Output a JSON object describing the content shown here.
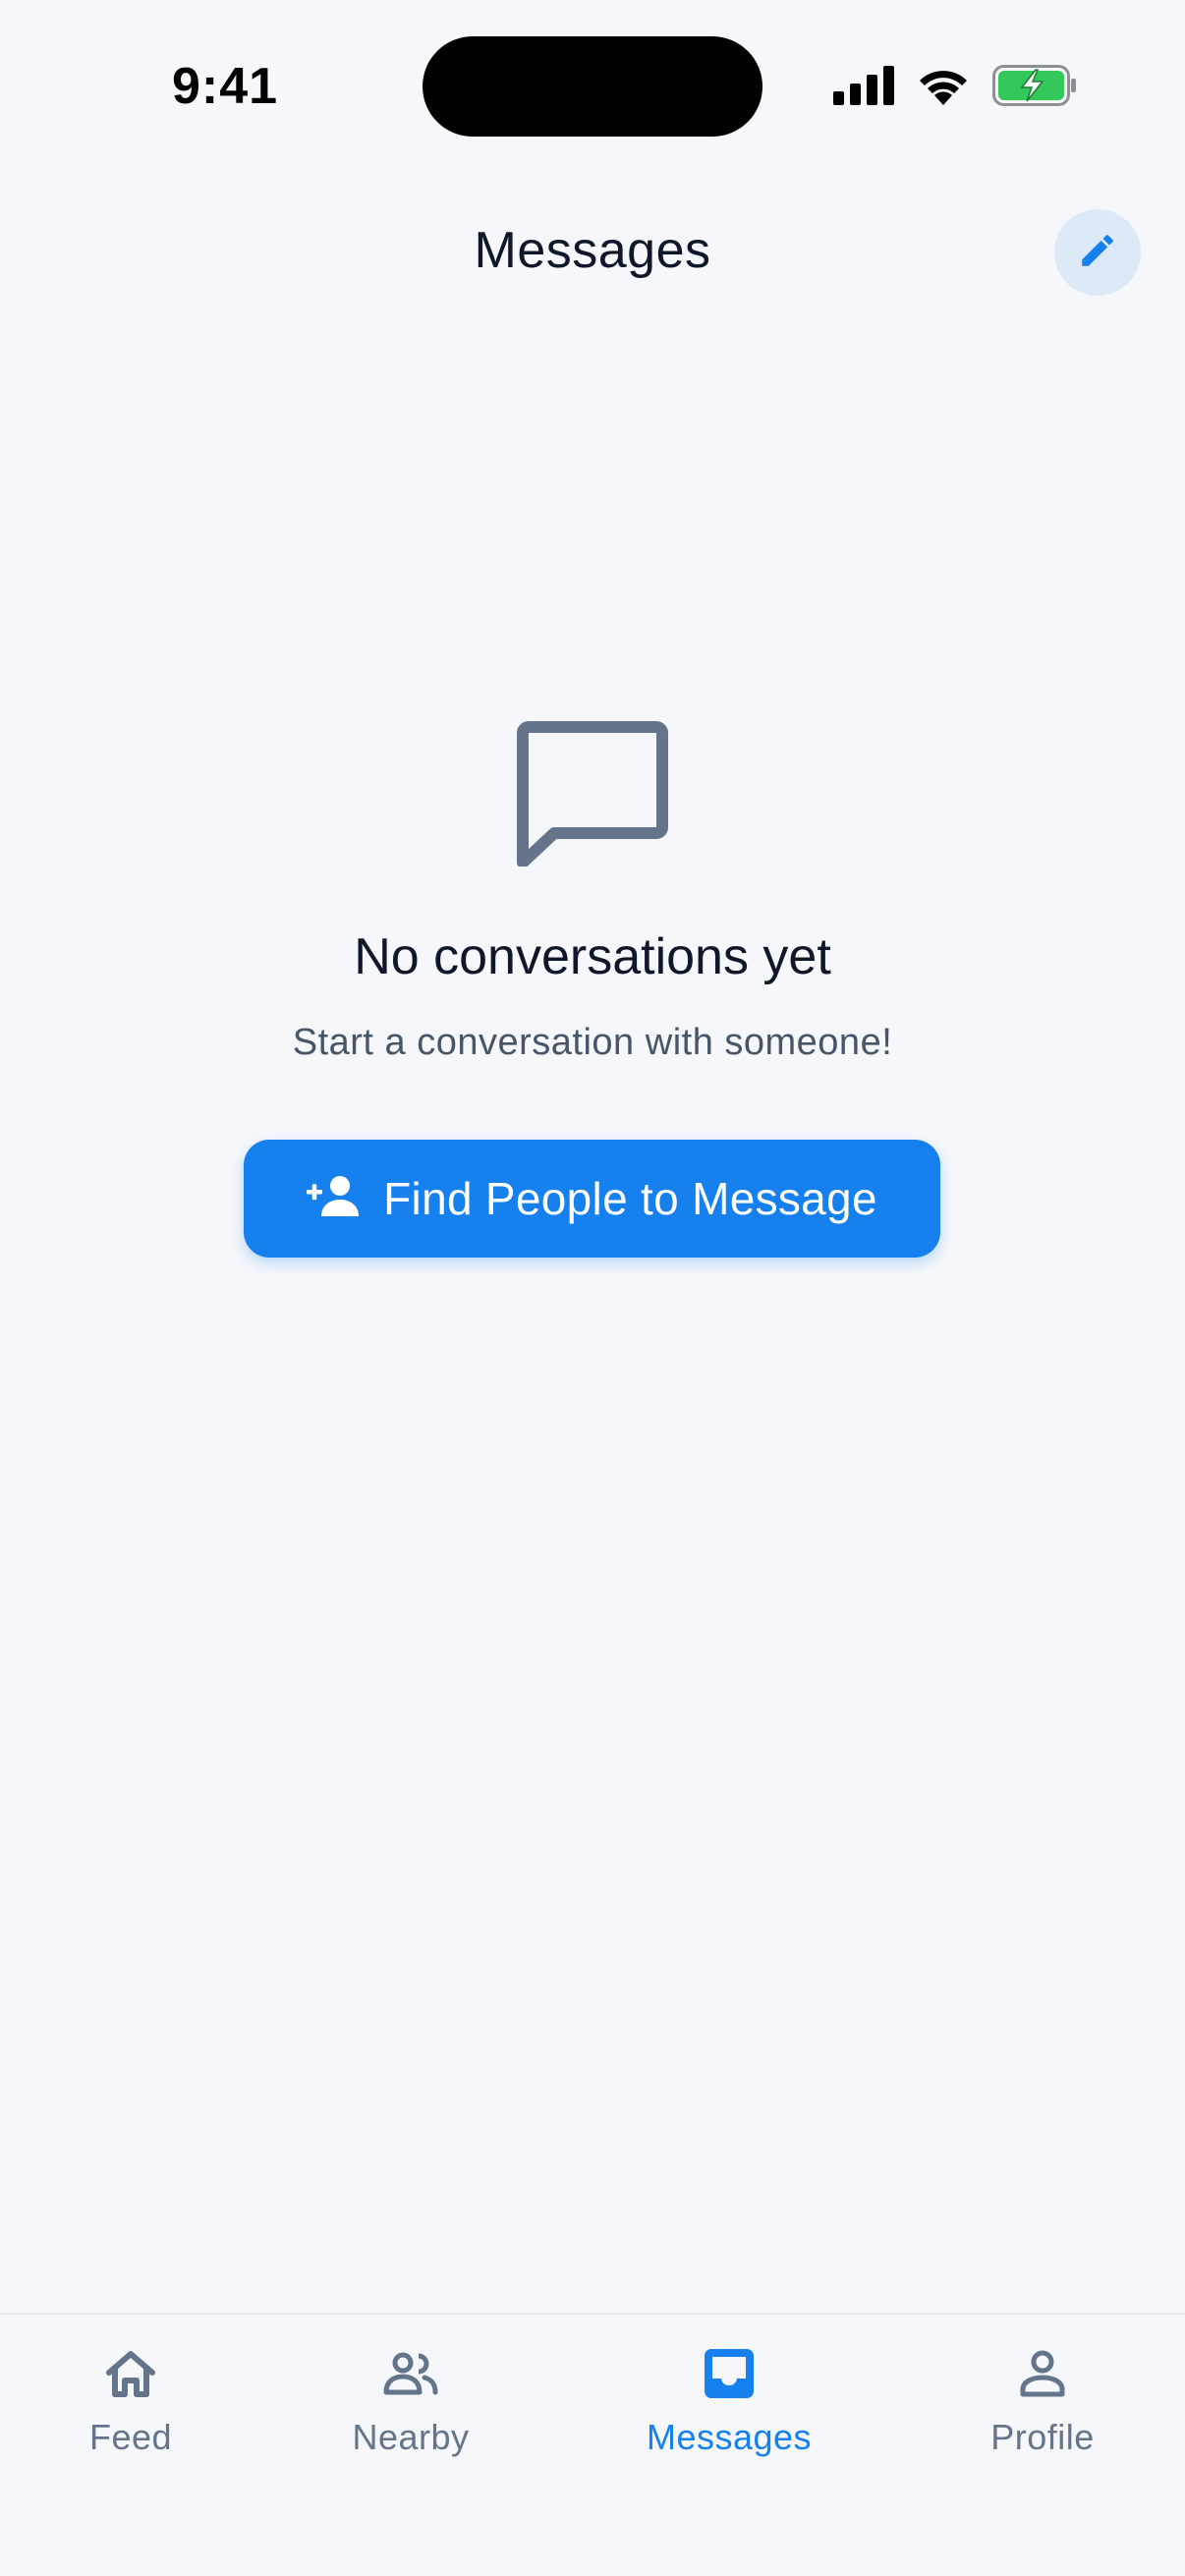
{
  "status_bar": {
    "time": "9:41"
  },
  "header": {
    "title": "Messages",
    "compose_icon": "pencil-icon"
  },
  "empty_state": {
    "icon": "chat-bubble-icon",
    "title": "No conversations yet",
    "subtitle": "Start a conversation with someone!",
    "button_label": "Find People to Message",
    "button_icon": "person-add-icon"
  },
  "bottom_nav": {
    "items": [
      {
        "label": "Feed",
        "icon": "home-icon",
        "active": false
      },
      {
        "label": "Nearby",
        "icon": "people-icon",
        "active": false
      },
      {
        "label": "Messages",
        "icon": "inbox-icon",
        "active": true
      },
      {
        "label": "Profile",
        "icon": "person-icon",
        "active": false
      }
    ]
  },
  "colors": {
    "accent": "#1580ee",
    "background": "#f5f7fa",
    "muted": "#64748b",
    "text": "#0f172a",
    "battery": "#34c759"
  }
}
